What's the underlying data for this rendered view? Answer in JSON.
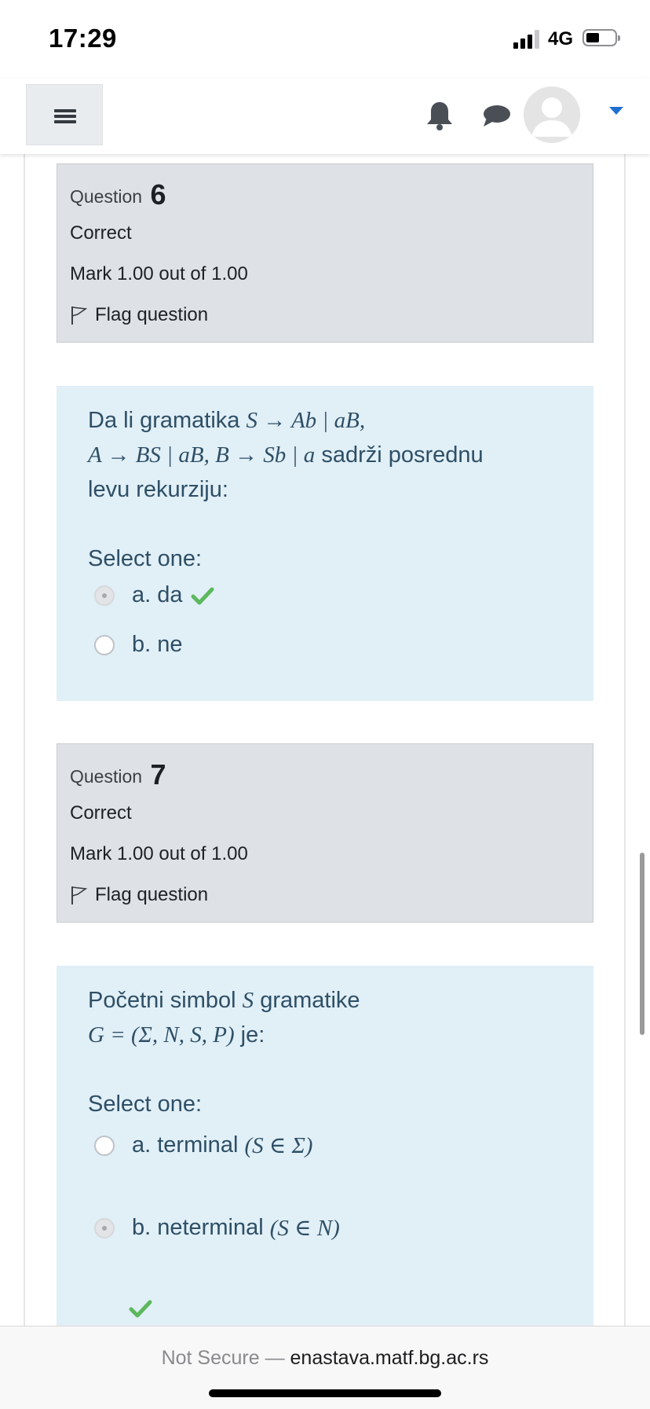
{
  "status": {
    "time": "17:29",
    "network": "4G"
  },
  "navbar": {
    "menu_icon": "hamburger-icon",
    "bell_icon": "bell-icon",
    "chat_icon": "chat-icon",
    "accent": "#1f6fd1"
  },
  "questions": [
    {
      "label": "Question",
      "number": "6",
      "state": "Correct",
      "grade": "Mark 1.00 out of 1.00",
      "flag": "Flag question",
      "text_line1_a": "Da li gramatika ",
      "text_line1_math": "S → Ab | aB,",
      "text_line2_math": "A → BS | aB, B → Sb | a",
      "text_line2_b": " sadrži posrednu",
      "text_line3": "levu rekurziju:",
      "prompt": "Select one:",
      "answers": [
        {
          "label": "a. da",
          "selected": true,
          "correct": true
        },
        {
          "label": "b. ne",
          "selected": false,
          "correct": false
        }
      ]
    },
    {
      "label": "Question",
      "number": "7",
      "state": "Correct",
      "grade": "Mark 1.00 out of 1.00",
      "flag": "Flag question",
      "text_line1_a": "Početni simbol ",
      "text_line1_math": "S",
      "text_line1_b": " gramatike",
      "text_line2_math": "G = (Σ, N, S, P)",
      "text_line2_b": " je:",
      "prompt": "Select one:",
      "answers": [
        {
          "label": "a. terminal ",
          "math": "(S ∈ Σ)",
          "selected": false,
          "correct": false
        },
        {
          "label": "b. neterminal ",
          "math": "(S ∈ N)",
          "selected": true,
          "correct": true
        }
      ]
    }
  ],
  "browser": {
    "not_secure": "Not Secure — ",
    "host": "enastava.matf.bg.ac.rs"
  },
  "colors": {
    "info_bg": "#dee2e6",
    "formulation_bg": "#e1eff7",
    "correct_green": "#5cb85c",
    "text_blue": "#2e4f66"
  }
}
